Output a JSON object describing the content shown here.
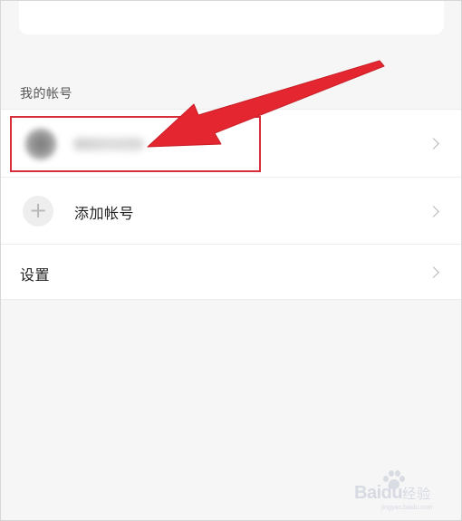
{
  "section": {
    "my_accounts_label": "我的帐号"
  },
  "accounts": {
    "current_account": {
      "avatar_icon": "blurred-avatar",
      "chevron_icon": "chevron-right-icon"
    },
    "add_account": {
      "icon": "plus-icon",
      "plus_glyph": "+",
      "label": "添加帐号",
      "chevron_icon": "chevron-right-icon"
    }
  },
  "settings": {
    "label": "设置",
    "chevron_icon": "chevron-right-icon"
  },
  "annotation": {
    "arrow_color": "#e3262f",
    "box_color": "#d92d3a"
  },
  "watermark": {
    "brand": "Bai",
    "brand_suffix": "du",
    "cn": "经验",
    "url": "jingyan.baidu.com"
  },
  "colors": {
    "background": "#f6f6f7",
    "card": "#ffffff",
    "chevron": "#b6b6b6",
    "label_text": "#222222",
    "section_text": "#555555"
  }
}
